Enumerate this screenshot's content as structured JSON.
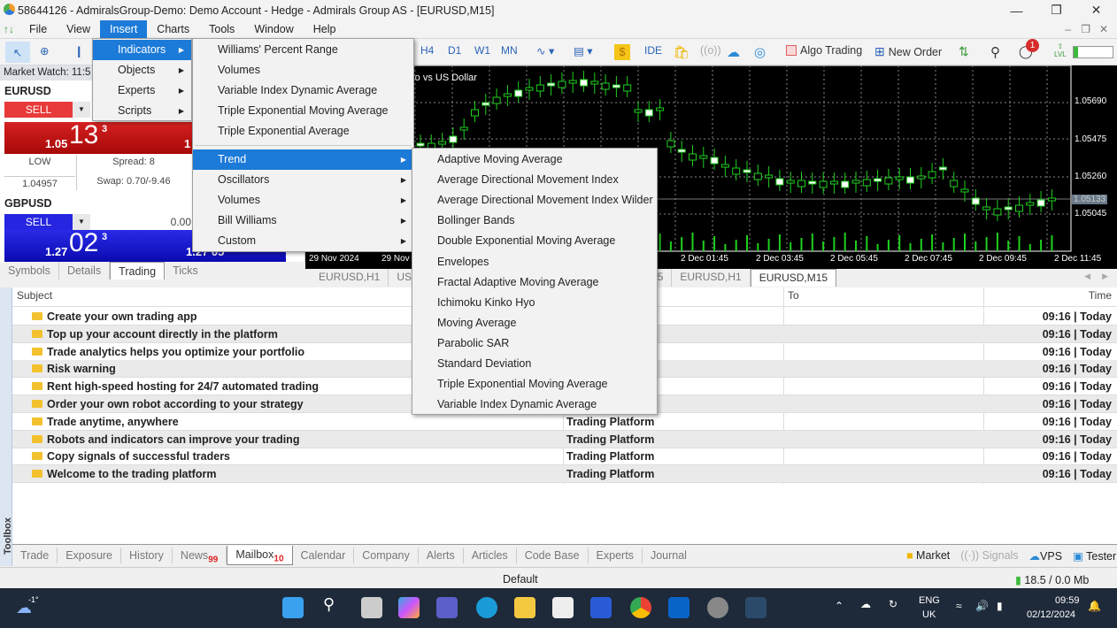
{
  "window": {
    "title": "58644126 - AdmiralsGroup-Demo: Demo Account - Hedge - Admirals Group AS - [EURUSD,M15]"
  },
  "menubar": [
    "File",
    "View",
    "Insert",
    "Charts",
    "Tools",
    "Window",
    "Help"
  ],
  "toolbar": {
    "timeframes": [
      "H4",
      "D1",
      "W1",
      "MN"
    ],
    "ide": "IDE",
    "algo_trading": "Algo Trading",
    "new_order": "New Order",
    "notification_count": "1",
    "level_label": "LVL"
  },
  "insert_menu": {
    "items": [
      {
        "label": "Indicators",
        "submenu": true
      },
      {
        "label": "Objects",
        "submenu": true
      },
      {
        "label": "Experts",
        "submenu": true
      },
      {
        "label": "Scripts",
        "submenu": true
      }
    ]
  },
  "indicators_menu": {
    "recent": [
      "Williams' Percent Range",
      "Volumes",
      "Variable Index Dynamic Average",
      "Triple Exponential Moving Average",
      "Triple Exponential Average"
    ],
    "groups": [
      "Trend",
      "Oscillators",
      "Volumes",
      "Bill Williams",
      "Custom"
    ]
  },
  "trend_menu": [
    "Adaptive Moving Average",
    "Average Directional Movement Index",
    "Average Directional Movement Index Wilder",
    "Bollinger Bands",
    "Double Exponential Moving Average",
    "Envelopes",
    "Fractal Adaptive Moving Average",
    "Ichimoku Kinko Hyo",
    "Moving Average",
    "Parabolic SAR",
    "Standard Deviation",
    "Triple Exponential Moving Average",
    "Variable Index Dynamic Average"
  ],
  "market_watch": {
    "header": "Market Watch: 11:5",
    "symbols": [
      {
        "name": "EURUSD",
        "sell": "SELL",
        "price_small": "1.05",
        "price_big": "13",
        "price_sup": "3",
        "right_price": "1",
        "low_label": "LOW",
        "low_value": "1.04957",
        "spread": "Spread: 8",
        "swap": "Swap: 0.70/-9.46"
      },
      {
        "name": "GBPUSD",
        "sell": "SELL",
        "lot": "0.00",
        "price_small": "1.27",
        "price_big": "02",
        "price_sup": "3",
        "right_price": "1.27 05"
      }
    ],
    "tabs": [
      "Symbols",
      "Details",
      "Trading",
      "Ticks"
    ],
    "active_tab": "Trading"
  },
  "chart": {
    "title": "ro vs US Dollar",
    "price_labels": [
      "1.05690",
      "1.05475",
      "1.05260",
      "1.05045"
    ],
    "current_price": "1.05133",
    "time_labels": [
      "29 Nov 2024",
      "29 Nov",
      "2 Dec 01:45",
      "2 Dec 03:45",
      "2 Dec 05:45",
      "2 Dec 07:45",
      "2 Dec 09:45",
      "2 Dec 11:45"
    ],
    "tabs": [
      "EURUSD,H1",
      "USD",
      "M5",
      "EURUSD,H1",
      "EURUSD,M15"
    ],
    "active_tab": "EURUSD,M15"
  },
  "mailbox": {
    "columns": [
      "Subject",
      "To",
      "Time"
    ],
    "rows": [
      {
        "subject": "Create your own trading app",
        "from": "",
        "time": "09:16 | Today"
      },
      {
        "subject": "Top up your account directly in the platform",
        "from": "",
        "time": "09:16 | Today"
      },
      {
        "subject": "Trade analytics helps you optimize your portfolio",
        "from": "",
        "time": "09:16 | Today"
      },
      {
        "subject": "Risk warning",
        "from": "",
        "time": "09:16 | Today"
      },
      {
        "subject": "Rent high-speed hosting for 24/7 automated trading",
        "from": "",
        "time": "09:16 | Today"
      },
      {
        "subject": "Order your own robot according to your strategy",
        "from": "",
        "time": "09:16 | Today"
      },
      {
        "subject": "Trade anytime, anywhere",
        "from": "Trading Platform",
        "time": "09:16 | Today"
      },
      {
        "subject": "Robots and indicators can improve your trading",
        "from": "Trading Platform",
        "time": "09:16 | Today"
      },
      {
        "subject": "Copy signals of successful traders",
        "from": "Trading Platform",
        "time": "09:16 | Today"
      },
      {
        "subject": "Welcome to the trading platform",
        "from": "Trading Platform",
        "time": "09:16 | Today"
      }
    ]
  },
  "toolbox": {
    "side_label": "Toolbox",
    "tabs": [
      {
        "label": "Trade"
      },
      {
        "label": "Exposure"
      },
      {
        "label": "History"
      },
      {
        "label": "News",
        "badge": "99"
      },
      {
        "label": "Mailbox",
        "badge": "10"
      },
      {
        "label": "Calendar"
      },
      {
        "label": "Company"
      },
      {
        "label": "Alerts"
      },
      {
        "label": "Articles"
      },
      {
        "label": "Code Base"
      },
      {
        "label": "Experts"
      },
      {
        "label": "Journal"
      }
    ],
    "active_tab": "Mailbox",
    "right_links": [
      "Market",
      "Signals",
      "VPS",
      "Tester"
    ]
  },
  "statusbar": {
    "profile": "Default",
    "traffic": "18.5 / 0.0 Mb"
  },
  "taskbar": {
    "weather": "-1°",
    "lang": "ENG",
    "region": "UK",
    "time": "09:59",
    "date": "02/12/2024"
  }
}
